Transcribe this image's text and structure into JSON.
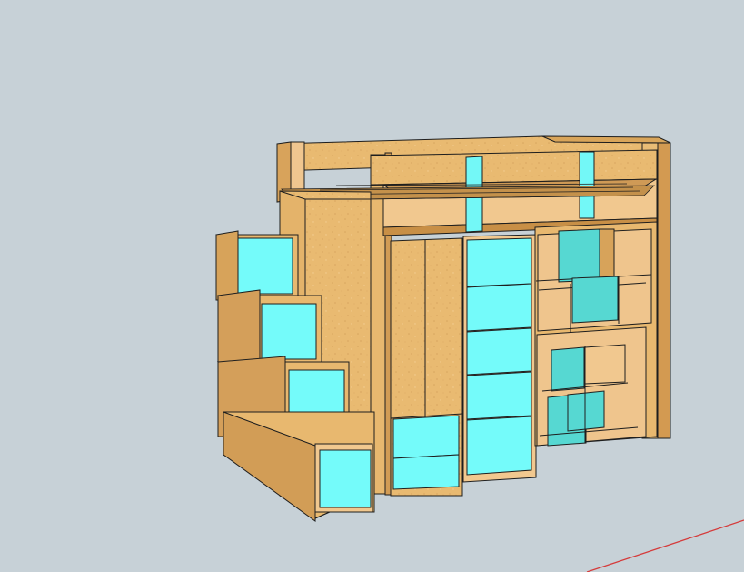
{
  "app": {
    "title": ""
  },
  "viewport": {
    "background_color": "#c7d1d7",
    "model": "loft-bed-with-storage-stairs-wardrobe-and-shelves"
  },
  "colors": {
    "wood_light": "#f1c88f",
    "wood_mid": "#e8b86f",
    "wood_dark": "#d6a15a",
    "wood_shadow": "#bc8a45",
    "edge": "#1e1e1e",
    "cyan_front": "#75fbfb",
    "cyan_mid": "#62e3e3",
    "cyan_shadow": "#4fd0cd",
    "axis_red": "#d53b3b"
  },
  "icons": {
    "axis": "red-axis-line"
  }
}
